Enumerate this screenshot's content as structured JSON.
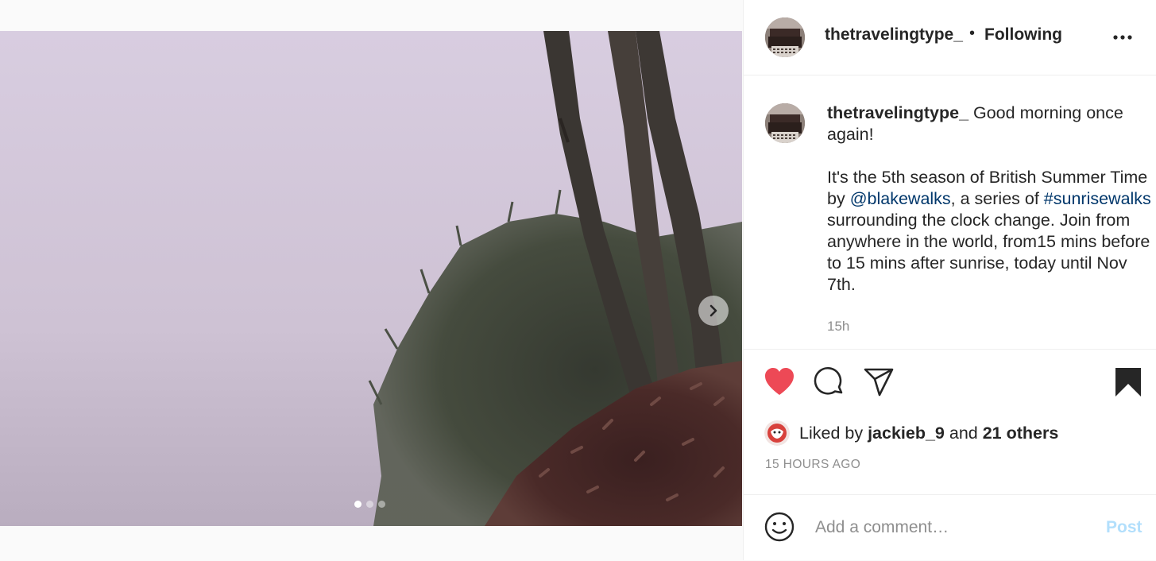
{
  "media": {
    "carousel_dots": 3,
    "active_dot": 0,
    "next_icon": "chevron-right-icon"
  },
  "header": {
    "username": "thetravelingtype_",
    "separator": "•",
    "follow_status": "Following",
    "more_icon": "more-options-icon"
  },
  "caption": {
    "username": "thetravelingtype_",
    "line1": " Good morning once again!\n\nIt's the 5th season of British Summer Time by ",
    "mention": "@blakewalks",
    "line2": ", a series of ",
    "hashtag": "#sunrisewalks",
    "line3": " surrounding the clock change. Join from anywhere in the world, from15 mins before to 15 mins after sunrise, today until Nov 7th.",
    "time": "15h"
  },
  "actions": {
    "liked": true,
    "saved": true,
    "like_color": "#ed4956"
  },
  "likes": {
    "prefix": "Liked by ",
    "user": "jackieb_9",
    "middle": " and ",
    "others": "21 others"
  },
  "timestamp": "15 HOURS AGO",
  "comment": {
    "placeholder": "Add a comment…",
    "post_label": "Post"
  }
}
